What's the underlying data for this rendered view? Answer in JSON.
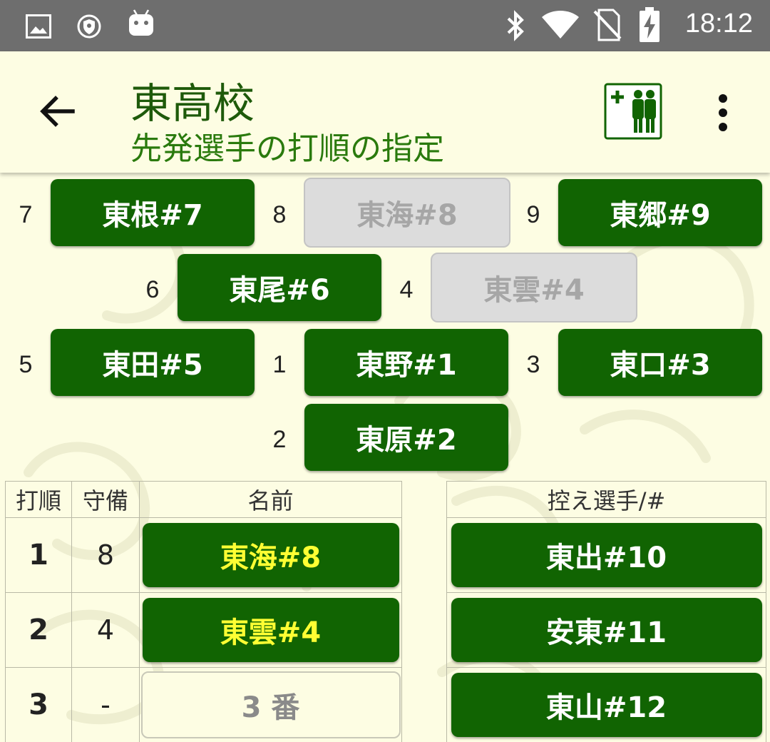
{
  "status_bar": {
    "time": "18:12",
    "icons": [
      "image-icon",
      "vpn-icon",
      "android-icon",
      "bluetooth-icon",
      "wifi-icon",
      "no-sim-icon",
      "battery-charging-icon"
    ]
  },
  "app_bar": {
    "title": "東高校",
    "subtitle": "先発選手の打順の指定",
    "icons": [
      "back-arrow-icon",
      "add-players-icon",
      "more-vert-icon"
    ]
  },
  "field": {
    "positions": [
      {
        "pos": "7",
        "name": "東根#7",
        "enabled": true
      },
      {
        "pos": "8",
        "name": "東海#8",
        "enabled": false
      },
      {
        "pos": "9",
        "name": "東郷#9",
        "enabled": true
      },
      {
        "pos": "6",
        "name": "東尾#6",
        "enabled": true
      },
      {
        "pos": "4",
        "name": "東雲#4",
        "enabled": false
      },
      {
        "pos": "5",
        "name": "東田#5",
        "enabled": true
      },
      {
        "pos": "1",
        "name": "東野#1",
        "enabled": true
      },
      {
        "pos": "3",
        "name": "東口#3",
        "enabled": true
      },
      {
        "pos": "2",
        "name": "東原#2",
        "enabled": true
      }
    ]
  },
  "lineup": {
    "headers": {
      "order": "打順",
      "defense": "守備",
      "name": "名前"
    },
    "rows": [
      {
        "order": "1",
        "defense": "8",
        "name": "東海#8"
      },
      {
        "order": "2",
        "defense": "4",
        "name": "東雲#4"
      },
      {
        "order": "3",
        "defense": "-",
        "name": "3 番"
      }
    ]
  },
  "bench": {
    "header": "控え選手/#",
    "players": [
      "東出#10",
      "安東#11",
      "東山#12"
    ]
  },
  "colors": {
    "accent": "#116402",
    "background": "#fdfde3",
    "highlight_text": "#ffff33",
    "title": "#1e5a0a"
  }
}
